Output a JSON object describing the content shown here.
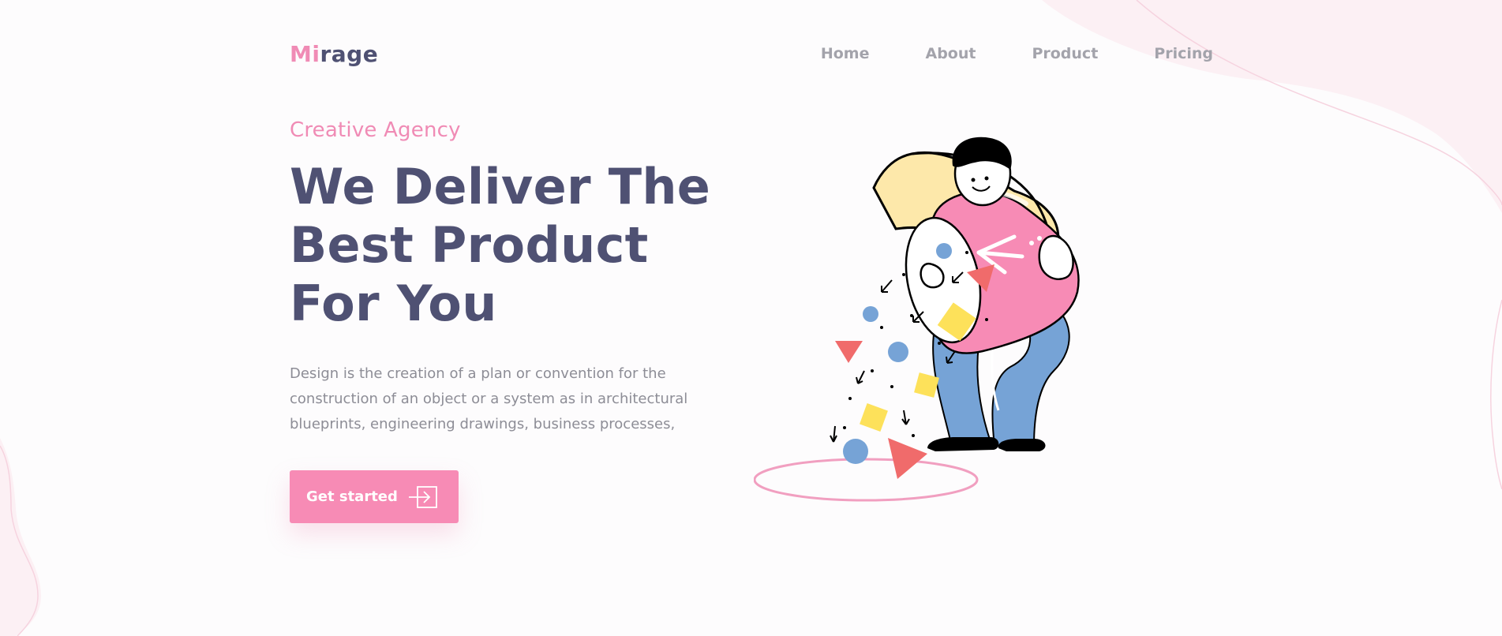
{
  "brand": {
    "logo_accent": "Mi",
    "logo_rest": "rage"
  },
  "nav": {
    "items": [
      {
        "label": "Home"
      },
      {
        "label": "About"
      },
      {
        "label": "Product"
      },
      {
        "label": "Pricing"
      }
    ]
  },
  "hero": {
    "eyebrow": "Creative Agency",
    "headline": "We Deliver The Best Product For You",
    "description": "Design is the creation of a plan or convention for the construction of an object or a system as in architectural blueprints, engineering drawings, business processes,",
    "cta_label": "Get started"
  },
  "colors": {
    "accent_pink": "#f78bb5",
    "heading": "#4f5173",
    "muted_text": "#8d8d96",
    "nav_text": "#a3a3ab",
    "background": "#fdfcfd"
  },
  "icons": {
    "cta": "arrow-into-box-icon"
  }
}
